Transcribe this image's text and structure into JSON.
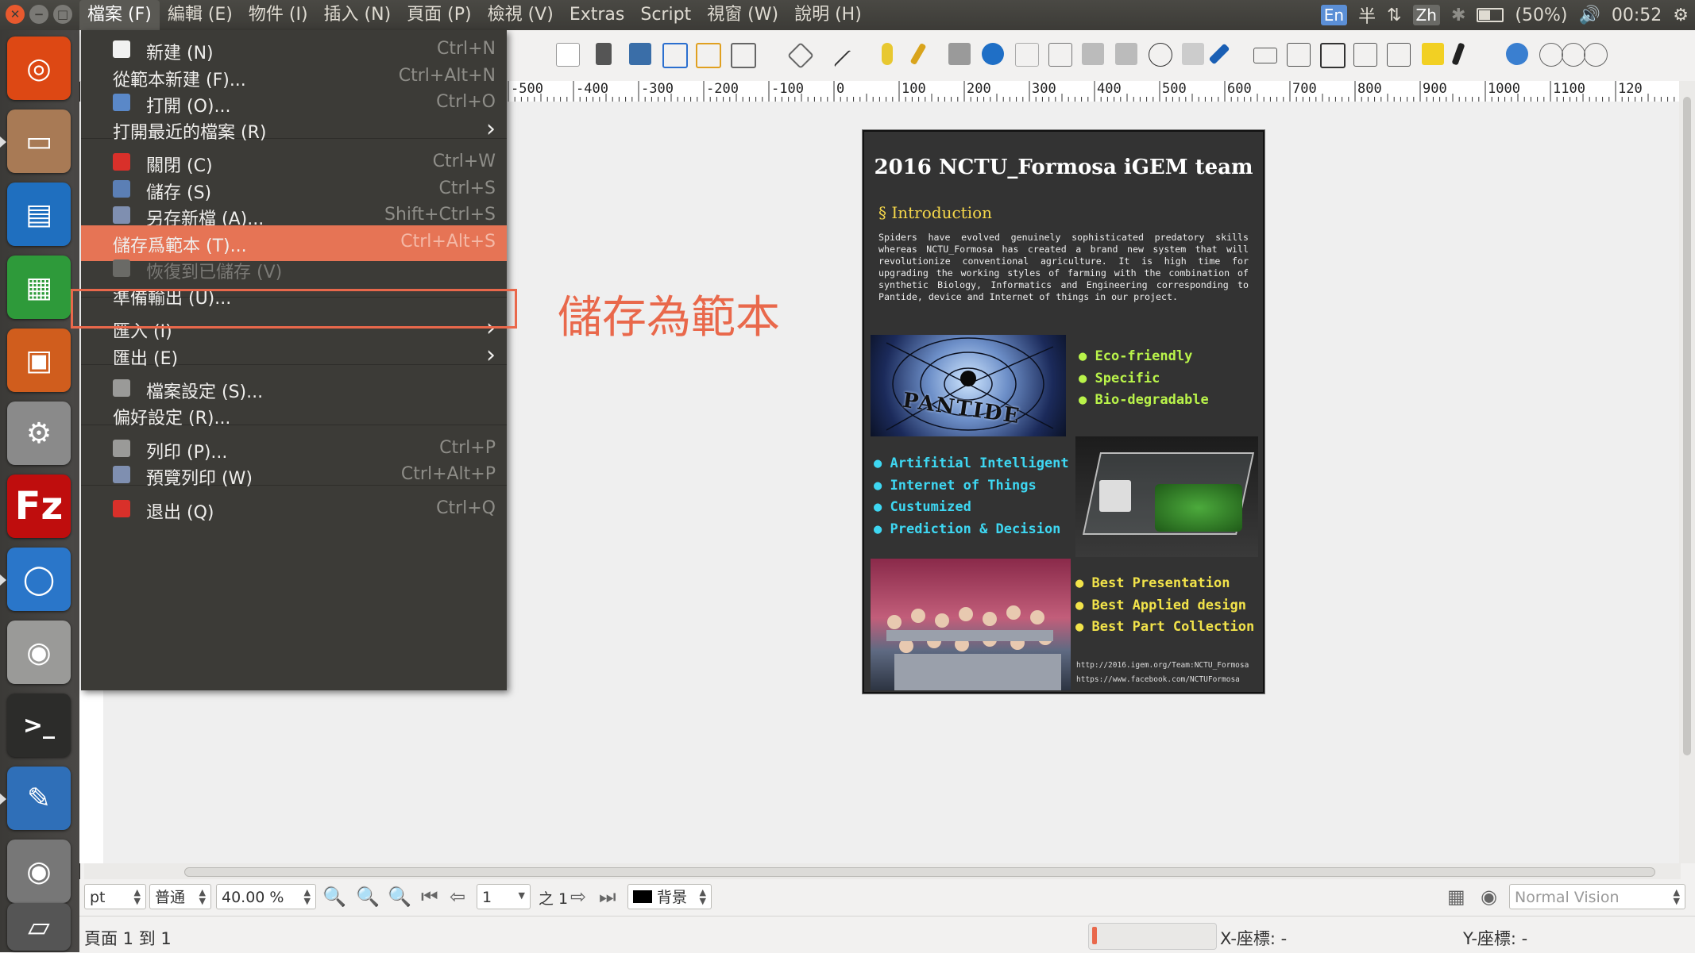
{
  "topbar": {
    "menus": [
      "檔案 (F)",
      "編輯 (E)",
      "物件 (I)",
      "插入 (N)",
      "頁面 (P)",
      "檢視 (V)",
      "Extras",
      "Script",
      "視窗 (W)",
      "說明 (H)"
    ],
    "tray": {
      "input_en": "En",
      "half": "半",
      "input_zh": "Zh",
      "battery": "(50%)",
      "time": "00:52"
    }
  },
  "file_menu": {
    "items": [
      {
        "label": "新建 (N)",
        "shortcut": "Ctrl+N"
      },
      {
        "label": "從範本新建 (F)...",
        "shortcut": "Ctrl+Alt+N"
      },
      {
        "label": "打開 (O)...",
        "shortcut": "Ctrl+O"
      },
      {
        "label": "打開最近的檔案 (R)",
        "shortcut": "›"
      },
      {
        "label": "關閉 (C)",
        "shortcut": "Ctrl+W"
      },
      {
        "label": "儲存 (S)",
        "shortcut": "Ctrl+S"
      },
      {
        "label": "另存新檔 (A)...",
        "shortcut": "Shift+Ctrl+S"
      },
      {
        "label": "儲存爲範本 (T)...",
        "shortcut": "Ctrl+Alt+S"
      },
      {
        "label": "恢復到已儲存 (V)",
        "shortcut": ""
      },
      {
        "label": "準備輸出 (U)...",
        "shortcut": ""
      },
      {
        "label": "匯入 (I)",
        "shortcut": "›"
      },
      {
        "label": "匯出 (E)",
        "shortcut": "›"
      },
      {
        "label": "檔案設定 (S)...",
        "shortcut": ""
      },
      {
        "label": "偏好設定 (R)...",
        "shortcut": ""
      },
      {
        "label": "列印 (P)...",
        "shortcut": "Ctrl+P"
      },
      {
        "label": "預覽列印 (W)",
        "shortcut": "Ctrl+Alt+P"
      },
      {
        "label": "退出 (Q)",
        "shortcut": "Ctrl+Q"
      }
    ],
    "highlighted_index": 7,
    "highlight_color": "#e67455"
  },
  "annotation": {
    "text": "儲存為範本",
    "color": "#e9684b"
  },
  "ruler": {
    "labels": [
      "-500",
      "-400",
      "-300",
      "-200",
      "-100",
      "0",
      "100",
      "200",
      "300",
      "400",
      "500",
      "600",
      "700",
      "800",
      "900",
      "1000",
      "1100",
      "120"
    ]
  },
  "poster": {
    "title": "2016 NCTU_Formosa iGEM team",
    "intro_heading": "§ Introduction",
    "intro_text": "Spiders have evolved genuinely sophisticated predatory skills whereas NCTU_Formosa has created a brand new system that will revolutionize conventional agriculture. It is high time for upgrading the working styles of farming with the combination of synthetic Biology, Informatics and Engineering corresponding to Pantide, device and Internet of things in our project.",
    "logo_text": "PANTIDE",
    "features_green": [
      "Eco-friendly",
      "Specific",
      "Bio-degradable"
    ],
    "features_cyan": [
      "Artifitial Intelligent",
      "Internet of Things",
      "Custumized",
      "Prediction & Decision"
    ],
    "awards": [
      "Best Presentation",
      "Best Applied design",
      "Best Part Collection"
    ],
    "urls": [
      "http://2016.igem.org/Team:NCTU_Formosa",
      "https://www.facebook.com/NCTUFormosa"
    ]
  },
  "bottombar": {
    "unit": "pt",
    "mode": "普通",
    "zoom": "40.00 %",
    "page_input": "1",
    "page_of": "之 1",
    "layer": "背景",
    "vision": "Normal Vision"
  },
  "statusbar": {
    "page_info": "頁面 1 到 1",
    "x_label": "X-座標: -",
    "y_label": "Y-座標: -"
  }
}
